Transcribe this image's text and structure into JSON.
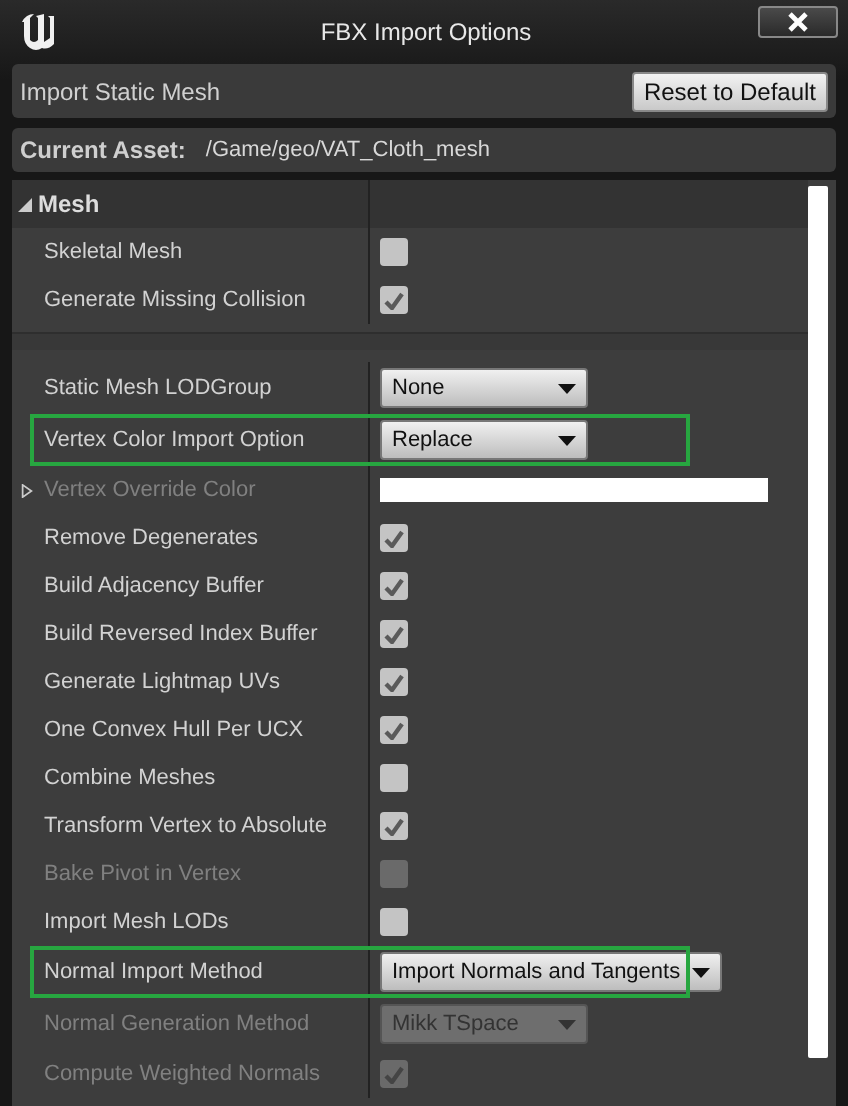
{
  "window": {
    "title": "FBX Import Options"
  },
  "header": {
    "label": "Import Static Mesh",
    "reset_button": "Reset to Default"
  },
  "asset": {
    "label": "Current Asset:",
    "path": "/Game/geo/VAT_Cloth_mesh"
  },
  "section": {
    "title": "Mesh",
    "expanded": true
  },
  "rows": [
    {
      "kind": "checkbox",
      "label": "Skeletal Mesh",
      "checked": false,
      "disabled": false
    },
    {
      "kind": "checkbox",
      "label": "Generate Missing Collision",
      "checked": true,
      "disabled": false
    },
    {
      "kind": "separator"
    },
    {
      "kind": "dropdown",
      "label": "Static Mesh LODGroup",
      "value": "None",
      "disabled": false
    },
    {
      "kind": "dropdown",
      "label": "Vertex Color Import Option",
      "value": "Replace",
      "disabled": false,
      "highlighted": true
    },
    {
      "kind": "color",
      "label": "Vertex Override Color",
      "color": "#ffffff",
      "disabled": true,
      "expanded": false
    },
    {
      "kind": "checkbox",
      "label": "Remove Degenerates",
      "checked": true,
      "disabled": false
    },
    {
      "kind": "checkbox",
      "label": "Build Adjacency Buffer",
      "checked": true,
      "disabled": false
    },
    {
      "kind": "checkbox",
      "label": "Build Reversed Index Buffer",
      "checked": true,
      "disabled": false
    },
    {
      "kind": "checkbox",
      "label": "Generate Lightmap UVs",
      "checked": true,
      "disabled": false
    },
    {
      "kind": "checkbox",
      "label": "One Convex Hull Per UCX",
      "checked": true,
      "disabled": false
    },
    {
      "kind": "checkbox",
      "label": "Combine Meshes",
      "checked": false,
      "disabled": false
    },
    {
      "kind": "checkbox",
      "label": "Transform Vertex to Absolute",
      "checked": true,
      "disabled": false
    },
    {
      "kind": "checkbox",
      "label": "Bake Pivot in Vertex",
      "checked": false,
      "disabled": true
    },
    {
      "kind": "checkbox",
      "label": "Import Mesh LODs",
      "checked": false,
      "disabled": false
    },
    {
      "kind": "dropdown",
      "label": "Normal Import Method",
      "value": "Import Normals and Tangents",
      "disabled": false,
      "highlighted": true
    },
    {
      "kind": "dropdown",
      "label": "Normal Generation Method",
      "value": "Mikk TSpace",
      "disabled": true
    },
    {
      "kind": "checkbox",
      "label": "Compute Weighted Normals",
      "checked": true,
      "disabled": true
    }
  ]
}
